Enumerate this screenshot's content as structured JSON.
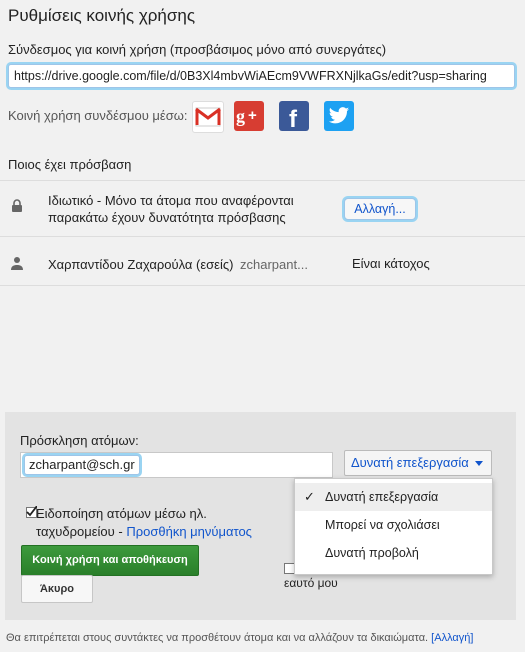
{
  "dialog": {
    "title": "Ρυθμίσεις κοινής χρήσης",
    "link_label": "Σύνδεσμος για κοινή χρήση (προσβάσιμος μόνο από συνεργάτες)",
    "share_url": "https://drive.google.com/file/d/0B3Xl4mbvWiAEcm9VWFRXNjlkaGs/edit?usp=sharing",
    "share_via_label": "Κοινή χρήση συνδέσμου μέσω:",
    "social": [
      {
        "name": "gmail",
        "icon": "gmail-icon",
        "color": "#ffffff"
      },
      {
        "name": "google-plus",
        "icon": "google-plus-icon",
        "color": "#d73d32"
      },
      {
        "name": "facebook",
        "icon": "facebook-icon",
        "color": "#3b5998"
      },
      {
        "name": "twitter",
        "icon": "twitter-icon",
        "color": "#1da1f2"
      }
    ]
  },
  "access": {
    "heading": "Ποιος έχει πρόσβαση",
    "privacy_text": "Ιδιωτικό - Μόνο τα άτομα που αναφέρονται παρακάτω έχουν δυνατότητα πρόσβασης",
    "change_label": "Αλλαγή...",
    "owner_name": "Χαρπαντίδου Ζαχαρούλα (εσείς)",
    "owner_email": "zcharpant...",
    "owner_role": "Είναι κάτοχος"
  },
  "invite": {
    "label": "Πρόσκληση ατόμων:",
    "chip": "zcharpant@sch.gr",
    "permission_selected": "Δυνατή επεξεργασία",
    "menu": [
      "Δυνατή επεξεργασία",
      "Μπορεί να σχολιάσει",
      "Δυνατή προβολή"
    ],
    "notify_text": "Ειδοποίηση ατόμων μέσω ηλ. ταχυδρομείου - ",
    "notify_link": "Προσθήκη μηνύματος",
    "notify_checked": true,
    "copy_myself_text": "εαυτό μου",
    "save_label": "Κοινή χρήση και αποθήκευση",
    "cancel_label": "Άκυρο"
  },
  "footer": {
    "text": "Θα επιτρέπεται στους συντάκτες να προσθέτουν άτομα και να αλλάζουν τα δικαιώματα.",
    "link": "[Αλλαγή]"
  },
  "colors": {
    "accent": "#1155cc",
    "save_green": "#2a7f2a",
    "focus_glow": "#9ad4f2"
  }
}
